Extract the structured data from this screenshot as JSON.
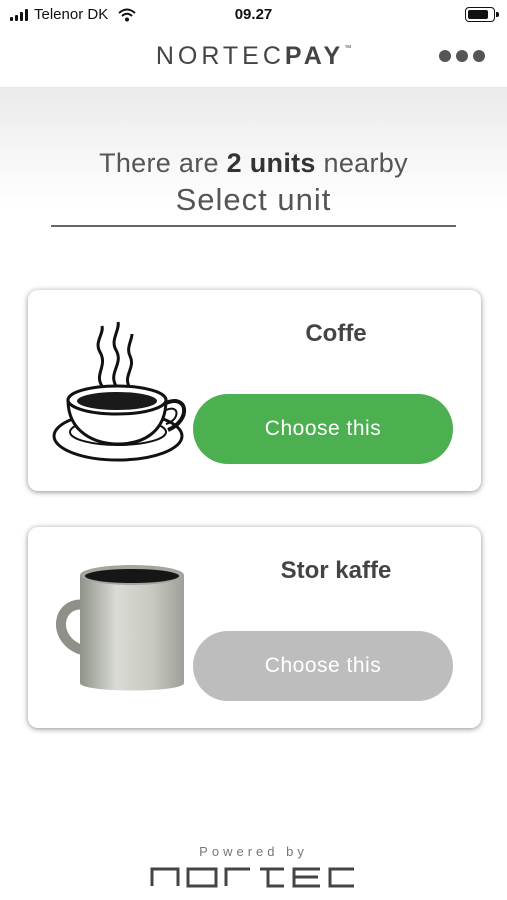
{
  "status_bar": {
    "carrier": "Telenor DK",
    "time": "09.27"
  },
  "header": {
    "brand_light": "NORTEC",
    "brand_bold": "PAY",
    "brand_tm": "™"
  },
  "main": {
    "nearby_prefix": "There are ",
    "nearby_count": "2 units",
    "nearby_suffix": " nearby",
    "select_label": "Select unit"
  },
  "units": [
    {
      "name": "Coffe",
      "button_label": "Choose this",
      "icon": "coffee-cup-icon",
      "button_color": "#4caf50"
    },
    {
      "name": "Stor kaffe",
      "button_label": "Choose this",
      "icon": "coffee-mug-icon",
      "button_color": "#bdbdbd"
    }
  ],
  "footer": {
    "powered_by": "Powered by",
    "logo_text": "nortec"
  }
}
